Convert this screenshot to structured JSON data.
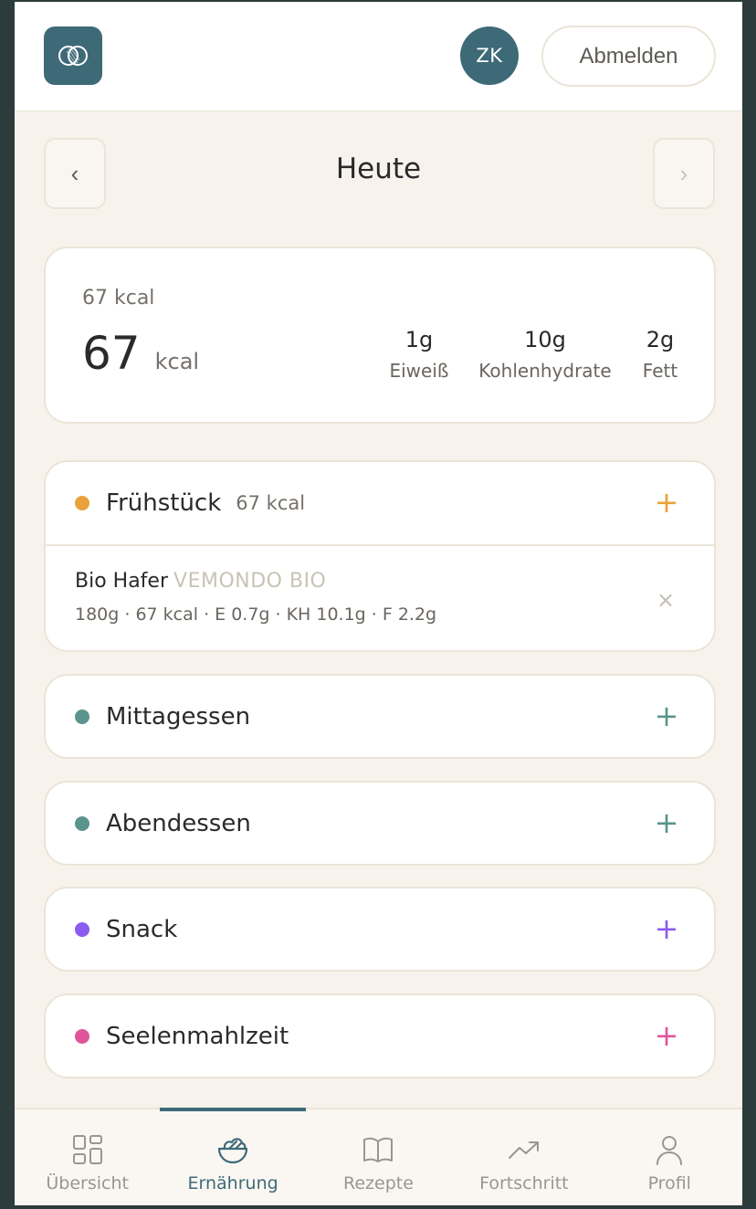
{
  "header": {
    "avatar_initials": "ZK",
    "logout_label": "Abmelden"
  },
  "day": {
    "title": "Heute",
    "prev": "‹",
    "next": "›"
  },
  "summary": {
    "small": "67 kcal",
    "total": "67",
    "unit": "kcal",
    "macros": [
      {
        "value": "1g",
        "label": "Eiweiß"
      },
      {
        "value": "10g",
        "label": "Kohlenhydrate"
      },
      {
        "value": "2g",
        "label": "Fett"
      }
    ]
  },
  "meals": [
    {
      "name": "Frühstück",
      "kcal": "67 kcal",
      "color": "#e9a23b",
      "items": [
        {
          "name": "Bio Hafer",
          "brand": "VEMONDO BIO",
          "detail": "180g · 67 kcal · E 0.7g · KH 10.1g · F 2.2g"
        }
      ]
    },
    {
      "name": "Mittagessen",
      "color": "#5a948c"
    },
    {
      "name": "Abendessen",
      "color": "#5a948c"
    },
    {
      "name": "Snack",
      "color": "#8a5cf0"
    },
    {
      "name": "Seelenmahlzeit",
      "color": "#e0559a"
    }
  ],
  "icons": {
    "plus": "+",
    "remove": "×"
  },
  "tabs": [
    {
      "label": "Übersicht",
      "icon": "grid-icon"
    },
    {
      "label": "Ernährung",
      "icon": "salad-bowl-icon",
      "active": true
    },
    {
      "label": "Rezepte",
      "icon": "book-icon"
    },
    {
      "label": "Fortschritt",
      "icon": "trend-icon"
    },
    {
      "label": "Profil",
      "icon": "user-icon"
    }
  ]
}
